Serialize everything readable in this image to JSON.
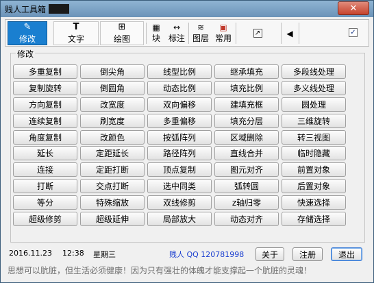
{
  "window": {
    "title": "贱人工具箱",
    "close_label": "✕"
  },
  "toolbar": {
    "tabs": [
      {
        "label": "修改",
        "icon": "edit-icon",
        "glyph": "✎"
      },
      {
        "label": "文字",
        "icon": "text-icon",
        "glyph": "T"
      },
      {
        "label": "绘图",
        "icon": "draw-icon",
        "glyph": "⊞"
      }
    ],
    "small_buttons": [
      {
        "label": "块",
        "icon": "block-icon",
        "glyph": "▦"
      },
      {
        "label": "标注",
        "icon": "dimension-icon",
        "glyph": "↔"
      },
      {
        "label": "图层",
        "icon": "layers-icon",
        "glyph": "≋"
      },
      {
        "label": "常用",
        "icon": "common-icon",
        "glyph": "▣"
      }
    ],
    "extra_icon": {
      "icon": "popout-icon",
      "glyph": "↗"
    },
    "scroll_icon": {
      "icon": "scroll-left-icon",
      "glyph": "◀"
    },
    "checkbox_checked": true
  },
  "group": {
    "label": "修改",
    "commands": [
      "多重复制",
      "倒尖角",
      "线型比例",
      "继承填充",
      "多段线处理",
      "复制旋转",
      "倒圆角",
      "动态比例",
      "填充比例",
      "多义线处理",
      "方向复制",
      "改宽度",
      "双向偏移",
      "建填充框",
      "圆处理",
      "连续复制",
      "刷宽度",
      "多重偏移",
      "填充分层",
      "三维旋转",
      "角度复制",
      "改颜色",
      "按弧阵列",
      "区域删除",
      "转三视图",
      "延长",
      "定距延长",
      "路径阵列",
      "直线合并",
      "临时隐藏",
      "连接",
      "定距打断",
      "顶点复制",
      "图元对齐",
      "前置对象",
      "打断",
      "交点打断",
      "选中同类",
      "弧转圆",
      "后置对象",
      "等分",
      "特殊缩放",
      "双线修剪",
      "z轴归零",
      "快速选择",
      "超级修剪",
      "超级延伸",
      "局部放大",
      "动态对齐",
      "存储选择"
    ]
  },
  "status": {
    "date": "2016.11.23",
    "time": "12:38",
    "weekday": "星期三",
    "author": "贱人 QQ 120781998"
  },
  "actions": {
    "about": "关于",
    "register": "注册",
    "exit": "退出"
  },
  "slogan": "思想可以肮脏，但生活必须健康！因为只有强壮的体魄才能支撑起一个肮脏的灵魂！",
  "colors": {
    "active_tab": "#1a7fd0",
    "author_text": "#1b3fd0"
  }
}
